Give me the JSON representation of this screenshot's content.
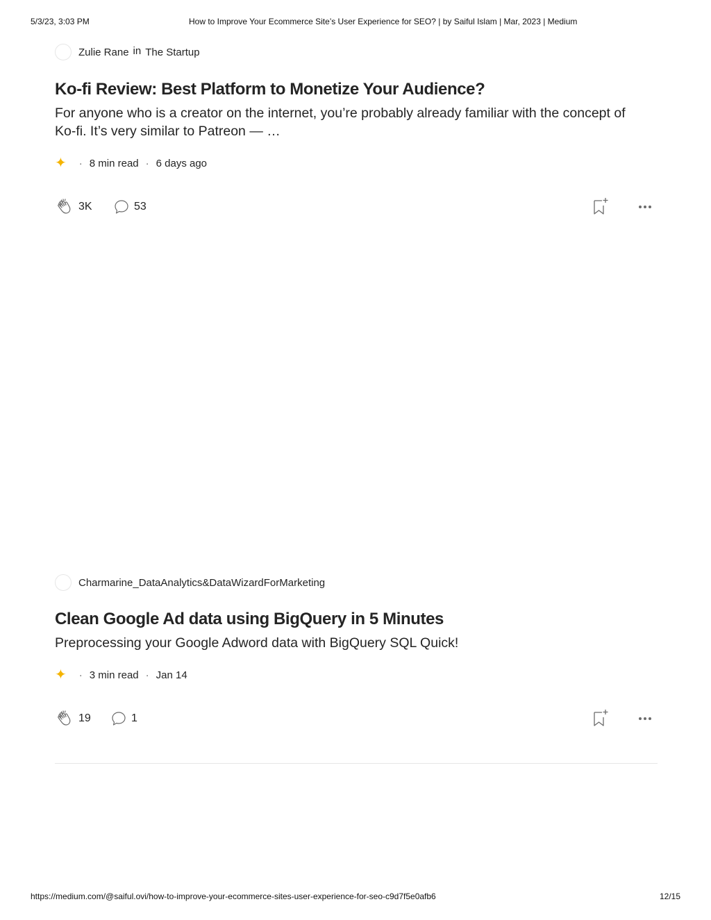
{
  "print_header": {
    "datetime": "5/3/23, 3:03 PM",
    "page_title": "How to Improve Your Ecommerce Site’s User Experience for SEO? | by Saiful Islam | Mar, 2023 | Medium"
  },
  "print_footer": {
    "url": "https://medium.com/@saiful.ovi/how-to-improve-your-ecommerce-sites-user-experience-for-seo-c9d7f5e0afb6",
    "page_number": "12/15"
  },
  "cards": [
    {
      "author": "Zulie Rane",
      "in_word": "in",
      "publication": "The Startup",
      "title": "Ko-fi Review: Best Platform to Monetize Your Audience?",
      "subtitle": "For anyone who is a creator on the internet, you’re probably already familiar with the concept of Ko-fi. It’s very similar to Patreon — …",
      "read_time": "8 min read",
      "date": "6 days ago",
      "claps": "3K",
      "responses": "53"
    },
    {
      "author": "Charmarine_DataAnalytics&DataWizardForMarketing",
      "title": "Clean Google Ad data using BigQuery in 5 Minutes",
      "subtitle": "Preprocessing your Google Adword data with BigQuery SQL Quick!",
      "read_time": "3 min read",
      "date": "Jan 14",
      "claps": "19",
      "responses": "1"
    }
  ],
  "icons": {
    "member_star": "sparkle-star-icon",
    "clap": "clap-icon",
    "response": "speech-bubble-icon",
    "save": "bookmark-add-icon",
    "more": "more-dots-icon"
  },
  "colors": {
    "star": "#f5b400",
    "text": "#242424",
    "muted": "#6b6b6b",
    "divider": "#e6e6e6"
  }
}
